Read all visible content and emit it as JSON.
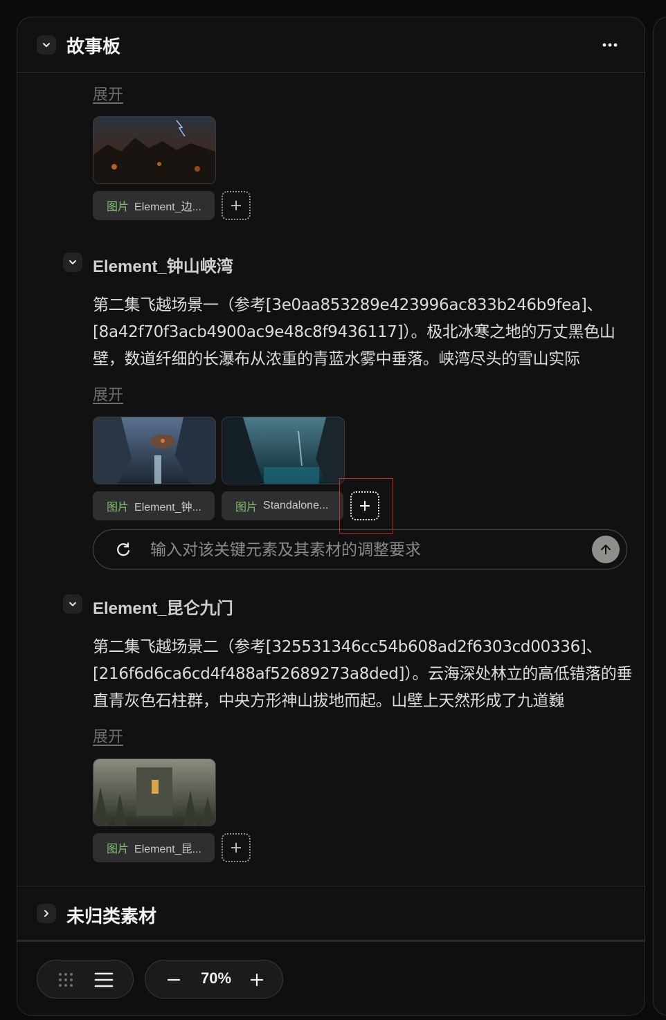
{
  "header": {
    "title": "故事板"
  },
  "expand_label": "展开",
  "section0": {
    "chips": [
      {
        "type": "图片",
        "name": "Element_边..."
      }
    ]
  },
  "section1": {
    "title": "Element_钟山峡湾",
    "description": "第二集飞越场景一（参考[3e0aa853289e423996ac833b246b9fea]、[8a42f70f3acb4900ac9e48c8f9436117]）。极北冰寒之地的万丈黑色山壁，数道纤细的长瀑布从浓重的青蓝水雾中垂落。峡湾尽头的雪山实际",
    "chips": [
      {
        "type": "图片",
        "name": "Element_钟..."
      },
      {
        "type": "图片",
        "name": "Standalone..."
      }
    ],
    "input_placeholder": "输入对该关键元素及其素材的调整要求"
  },
  "section2": {
    "title": "Element_昆仑九门",
    "description": "第二集飞越场景二（参考[325531346cc54b608ad2f6303cd00336]、[216f6d6ca6cd4f488af52689273a8ded]）。云海深处林立的高低错落的垂直青灰色石柱群，中央方形神山拔地而起。山壁上天然形成了九道巍",
    "chips": [
      {
        "type": "图片",
        "name": "Element_昆..."
      }
    ]
  },
  "uncategorized": {
    "title": "未归类素材"
  },
  "zoom": {
    "value": "70%"
  }
}
